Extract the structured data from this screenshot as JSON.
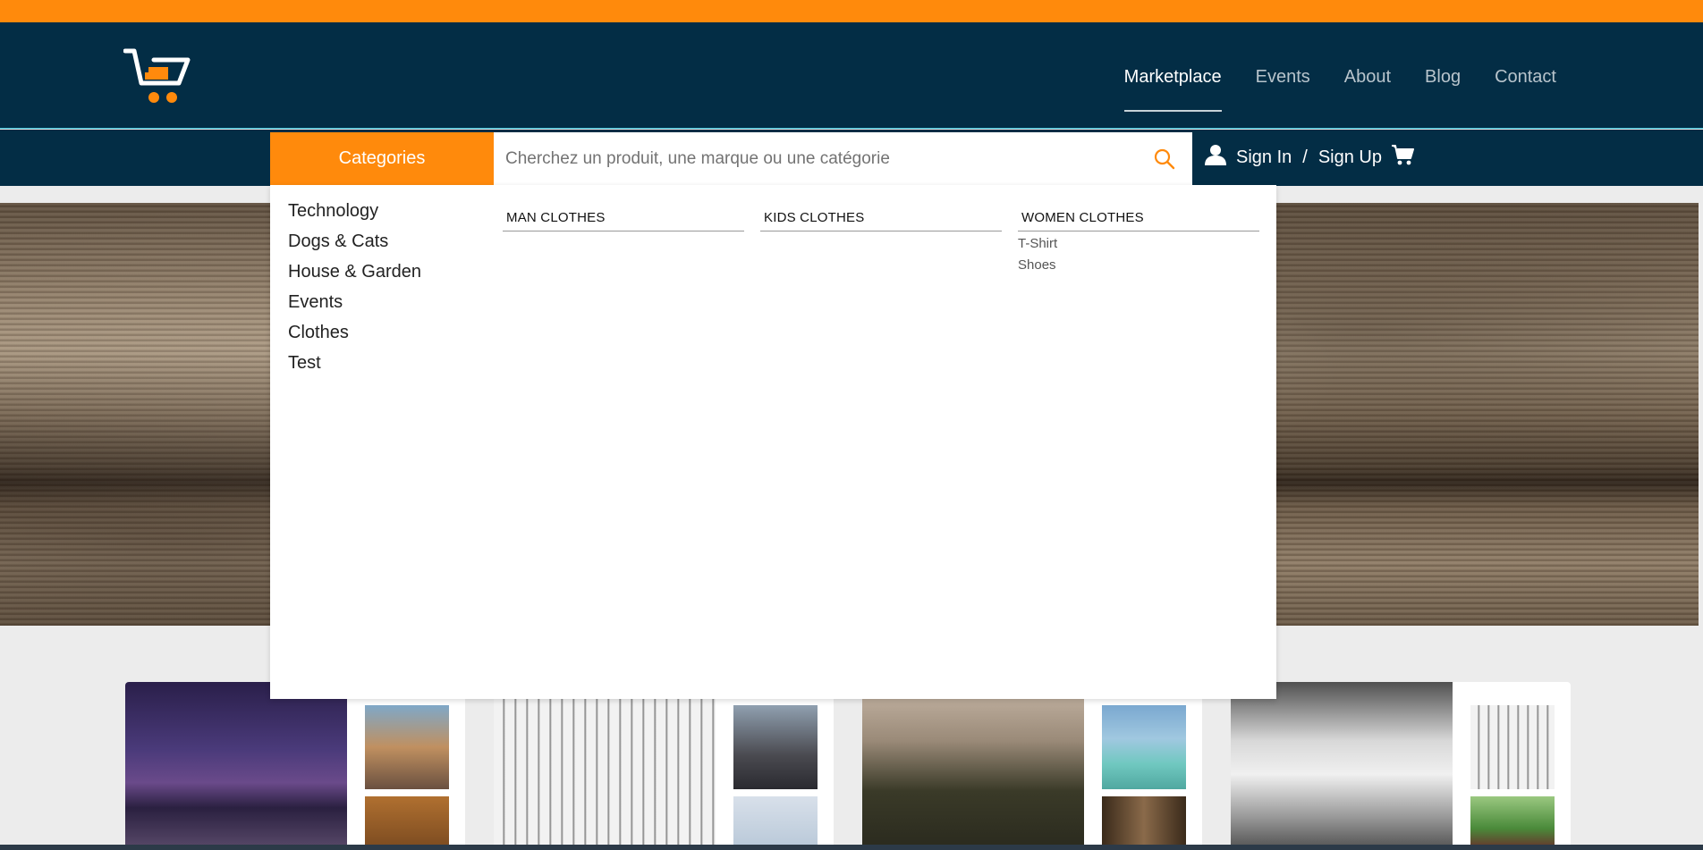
{
  "brand": {
    "logo_icon": "shopping-cart-logo-icon",
    "accent": "#ff8a0c",
    "navy": "#032d45"
  },
  "nav": {
    "items": [
      {
        "label": "Marketplace",
        "active": true
      },
      {
        "label": "Events",
        "active": false
      },
      {
        "label": "About",
        "active": false
      },
      {
        "label": "Blog",
        "active": false
      },
      {
        "label": "Contact",
        "active": false
      }
    ]
  },
  "search": {
    "categories_label": "Categories",
    "placeholder": "Cherchez un produit, une marque ou une catégorie",
    "value": "",
    "search_icon": "search-icon"
  },
  "account": {
    "sign_in": "Sign In",
    "separator": "/",
    "sign_up": "Sign Up",
    "user_icon": "user-icon",
    "cart_icon": "cart-icon"
  },
  "dropdown": {
    "categories": [
      "Technology",
      "Dogs & Cats",
      "House & Garden",
      "Events",
      "Clothes",
      "Test"
    ],
    "columns": [
      {
        "title": "MAN CLOTHES",
        "items": []
      },
      {
        "title": "KIDS CLOTHES",
        "items": []
      },
      {
        "title": "WOMEN CLOTHES",
        "items": [
          "T-Shirt",
          "Shoes"
        ]
      }
    ]
  }
}
